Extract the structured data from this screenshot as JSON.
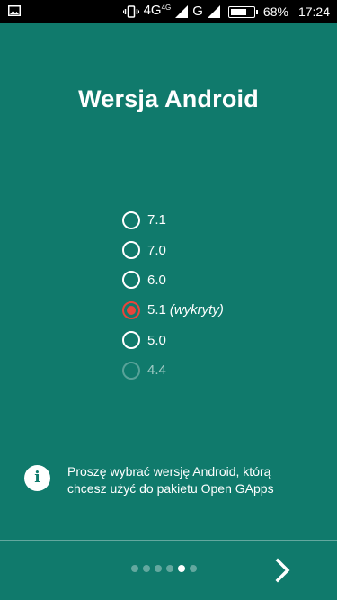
{
  "status_bar": {
    "network_primary": "4G",
    "network_sup": "4G",
    "network_secondary": "G",
    "battery_percent": "68%",
    "battery_level": 0.68,
    "time": "17:24",
    "icons": [
      "image-icon",
      "vibrate-icon",
      "signal-icon",
      "signal-icon",
      "battery-icon"
    ]
  },
  "title": "Wersja Android",
  "versions": [
    {
      "label": "7.1",
      "note": "",
      "selected": false,
      "disabled": false
    },
    {
      "label": "7.0",
      "note": "",
      "selected": false,
      "disabled": false
    },
    {
      "label": "6.0",
      "note": "",
      "selected": false,
      "disabled": false
    },
    {
      "label": "5.1",
      "note": "(wykryty)",
      "selected": true,
      "disabled": false
    },
    {
      "label": "5.0",
      "note": "",
      "selected": false,
      "disabled": false
    },
    {
      "label": "4.4",
      "note": "",
      "selected": false,
      "disabled": true
    }
  ],
  "info": {
    "icon_glyph": "i",
    "line1": "Proszę wybrać wersję Android, którą",
    "line2": "chcesz użyć do pakietu Open GApps"
  },
  "pager": {
    "total": 6,
    "current": 5
  },
  "next_icon": "chevron-right-icon",
  "colors": {
    "background": "#107a6c",
    "accent": "#e8453c",
    "status_bar": "#000000"
  }
}
